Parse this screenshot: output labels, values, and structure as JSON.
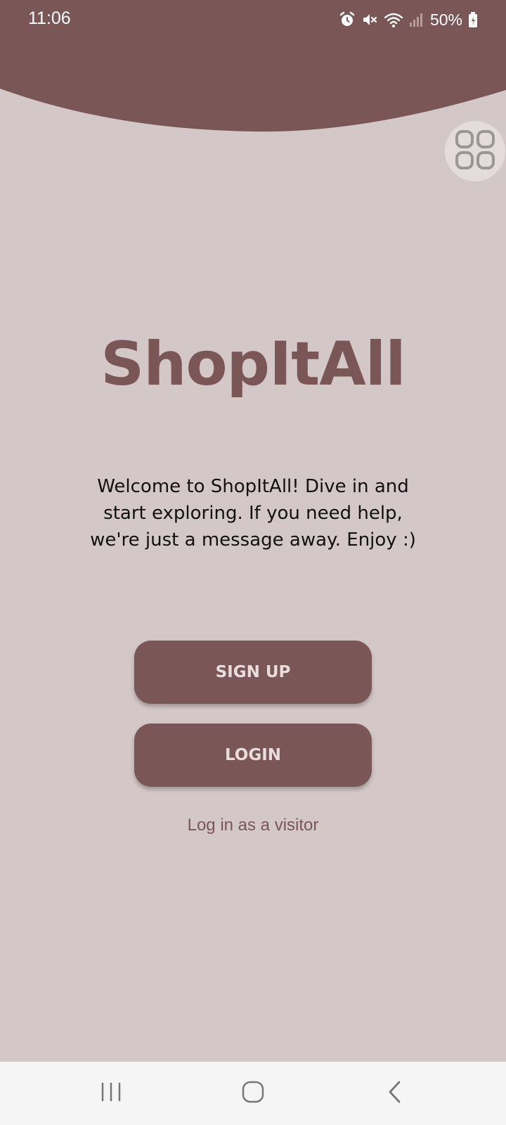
{
  "status_bar": {
    "time": "11:06",
    "battery": "50%",
    "icons": [
      "alarm-icon",
      "mute-icon",
      "wifi-icon",
      "signal-icon",
      "battery-icon"
    ]
  },
  "colors": {
    "primary": "#7b5656",
    "background": "#d4c7c8",
    "button_text": "#e9dcdc",
    "nav_background": "#f5f5f5"
  },
  "floating_menu": {
    "icon": "grid-icon"
  },
  "main": {
    "title": "ShopItAll",
    "welcome": "Welcome to ShopItAll! Dive in and start exploring. If you need help, we're just a message away. Enjoy :)",
    "signup_label": "SIGN UP",
    "login_label": "LOGIN",
    "visitor_label": "Log in as a visitor"
  },
  "nav_bar": {
    "items": [
      "recent-apps-icon",
      "home-icon",
      "back-icon"
    ]
  }
}
